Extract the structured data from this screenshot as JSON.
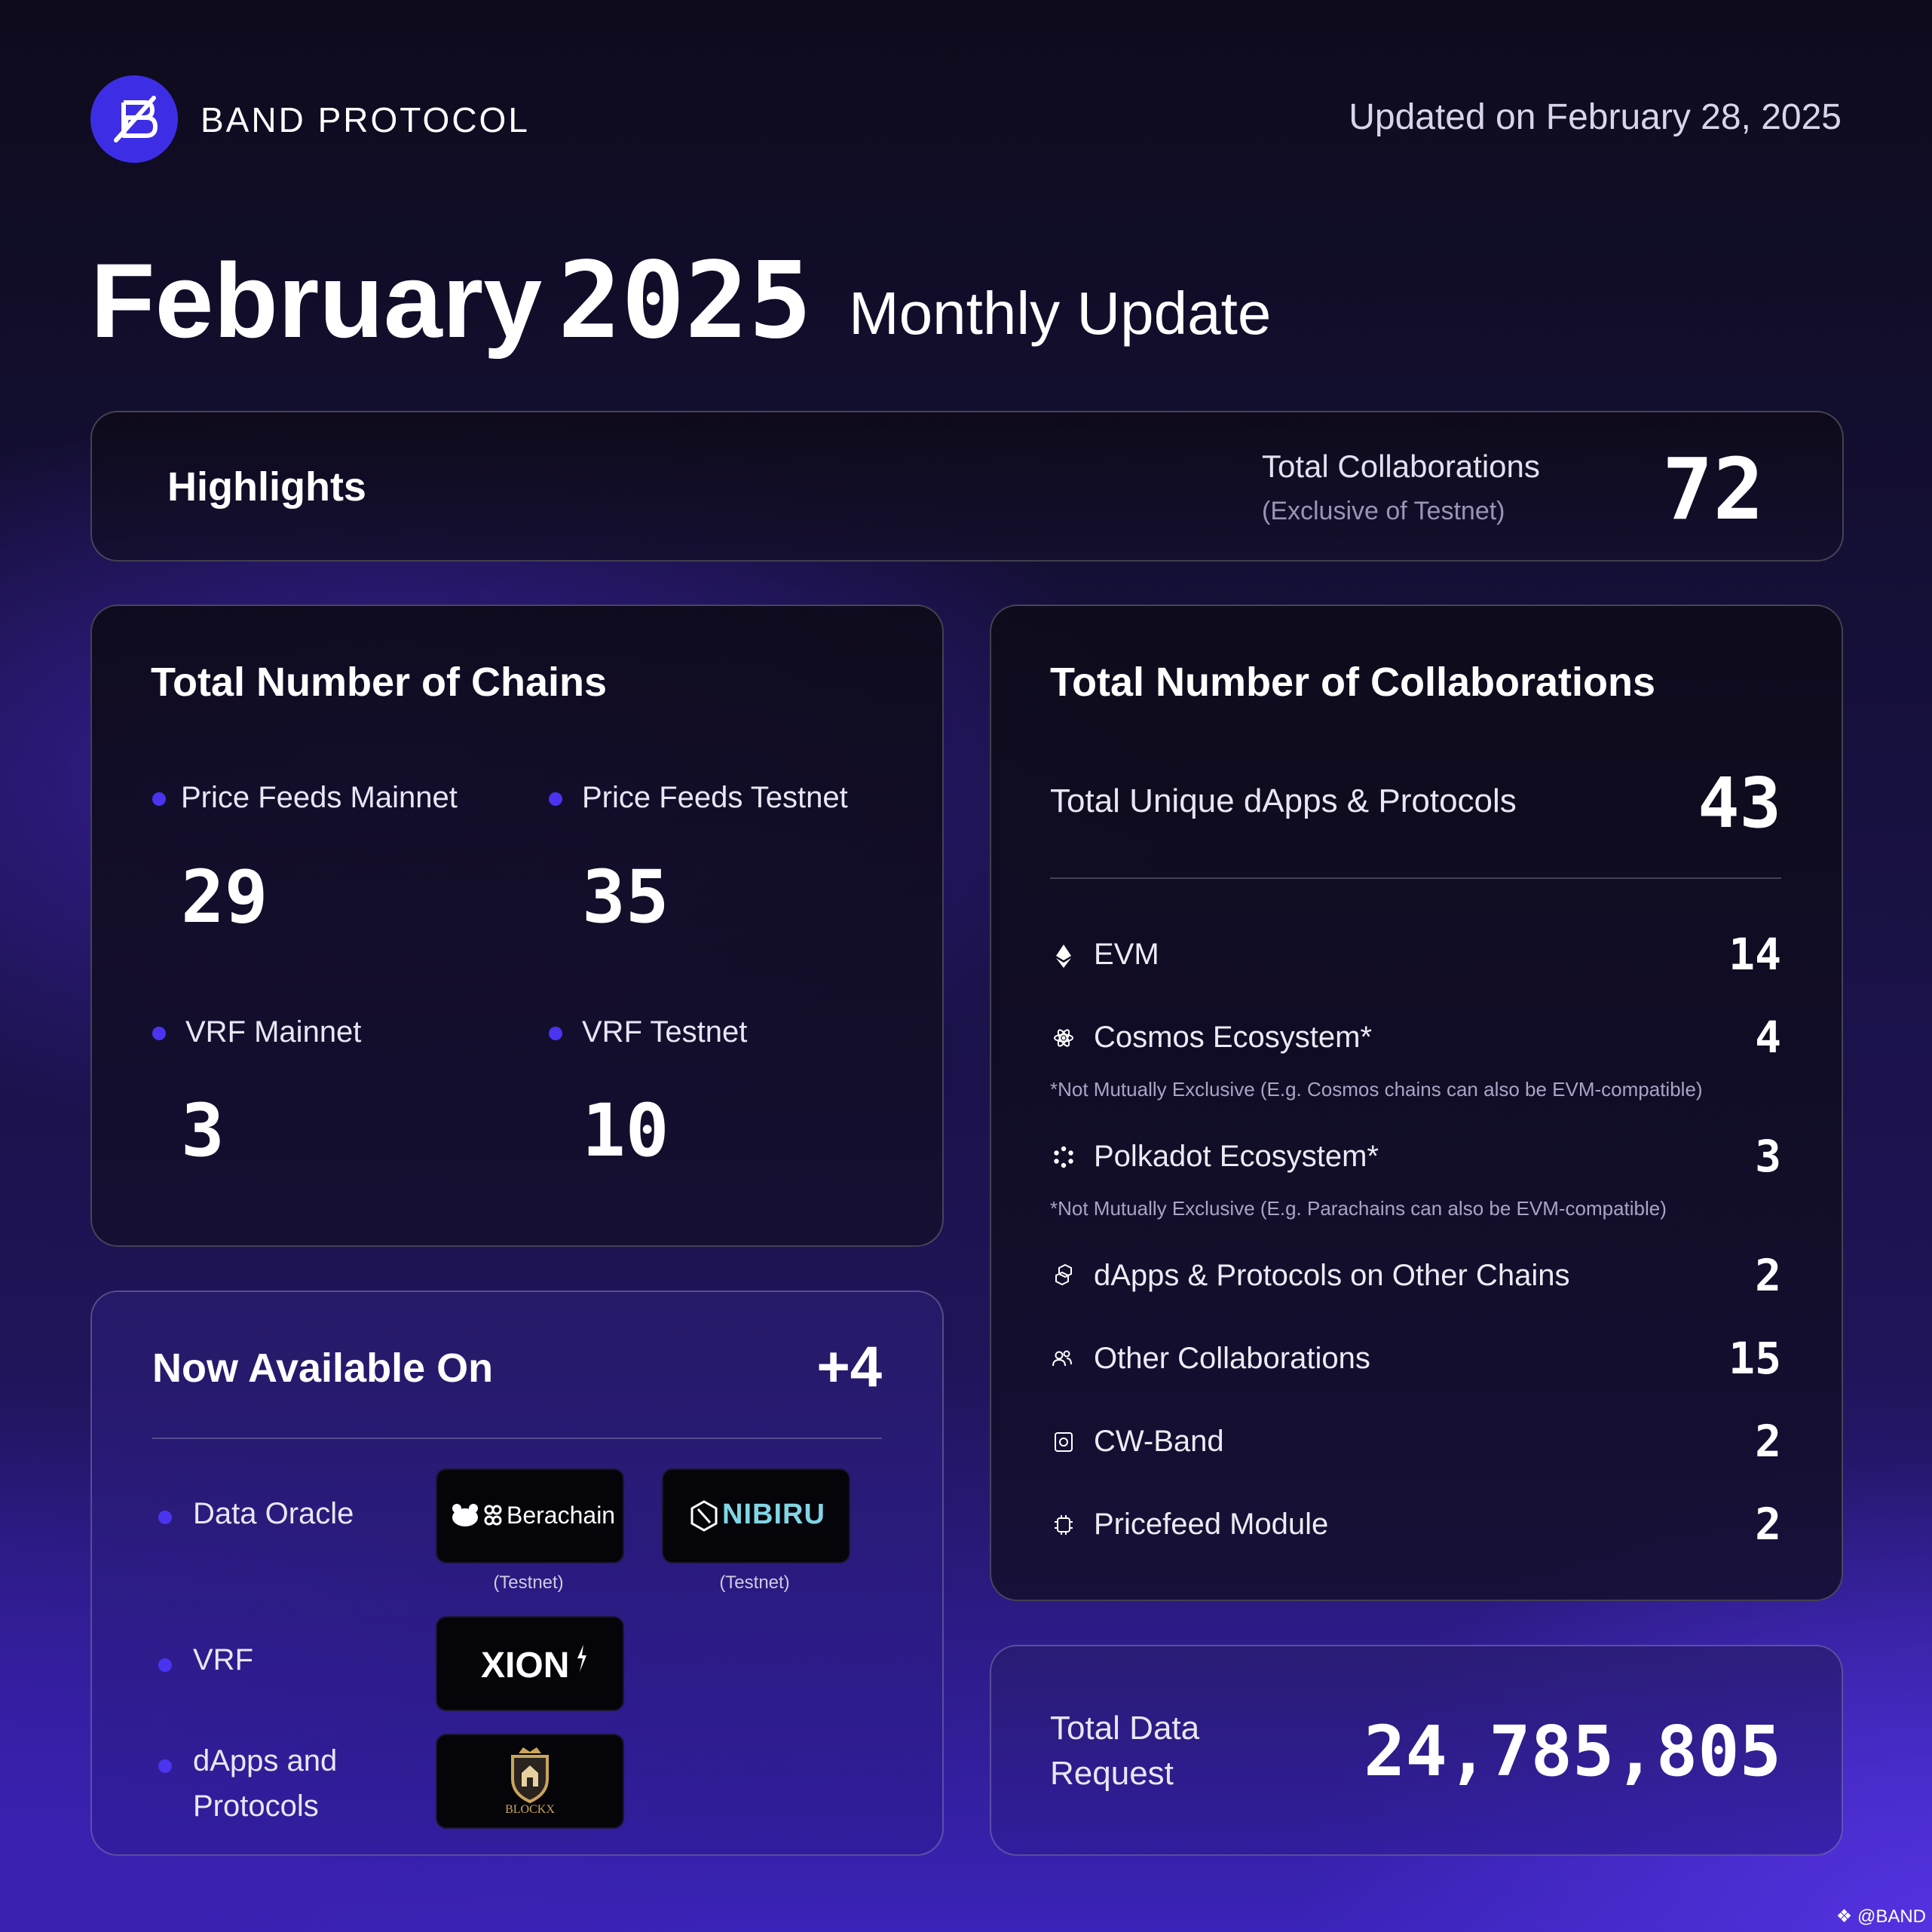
{
  "brand": {
    "name": "BAND PROTOCOL"
  },
  "updated": "Updated on February 28, 2025",
  "title": {
    "month_year": "February",
    "year": "2025",
    "subtitle": "Monthly Update"
  },
  "highlights": {
    "label": "Highlights",
    "total_label": "Total Collaborations",
    "total_sub": "(Exclusive of Testnet)",
    "total_value": "72"
  },
  "chains": {
    "title": "Total Number of Chains",
    "items": [
      {
        "label": "Price Feeds Mainnet",
        "value": "29"
      },
      {
        "label": "Price Feeds Testnet",
        "value": "35"
      },
      {
        "label": "VRF Mainnet",
        "value": "3"
      },
      {
        "label": "VRF Testnet",
        "value": "10"
      }
    ]
  },
  "available": {
    "title": "Now Available On",
    "count": "+4",
    "rows": [
      {
        "label": "Data Oracle"
      },
      {
        "label": "VRF"
      },
      {
        "label": "dApps and Protocols"
      }
    ],
    "logos": {
      "berachain": "Berachain",
      "nibiru": "NIBIRU",
      "xion": "XION",
      "blockx": "BLOCKX",
      "testnet": "(Testnet)"
    }
  },
  "collabs": {
    "title": "Total Number of Collaborations",
    "unique_label": "Total Unique dApps & Protocols",
    "unique_value": "43",
    "rows": [
      {
        "icon": "ethereum-icon",
        "label": "EVM",
        "value": "14"
      },
      {
        "icon": "cosmos-icon",
        "label": "Cosmos Ecosystem*",
        "value": "4",
        "note": "*Not Mutually Exclusive (E.g. Cosmos chains can also be EVM-compatible)"
      },
      {
        "icon": "polkadot-icon",
        "label": "Polkadot Ecosystem*",
        "value": "3",
        "note": "*Not Mutually Exclusive (E.g. Parachains can also be  EVM-compatible)"
      },
      {
        "icon": "cubes-icon",
        "label": "dApps & Protocols on Other Chains",
        "value": "2"
      },
      {
        "icon": "people-icon",
        "label": "Other Collaborations",
        "value": "15"
      },
      {
        "icon": "cw-band-icon",
        "label": "CW-Band",
        "value": "2"
      },
      {
        "icon": "chip-icon",
        "label": "Pricefeed Module",
        "value": "2"
      }
    ]
  },
  "data_request": {
    "label_line1": "Total Data",
    "label_line2": "Request",
    "value": "24,785,805"
  },
  "watermark": "@BAND",
  "colors": {
    "accent": "#4a34f0",
    "logo_bg": "#3d2ee6"
  }
}
